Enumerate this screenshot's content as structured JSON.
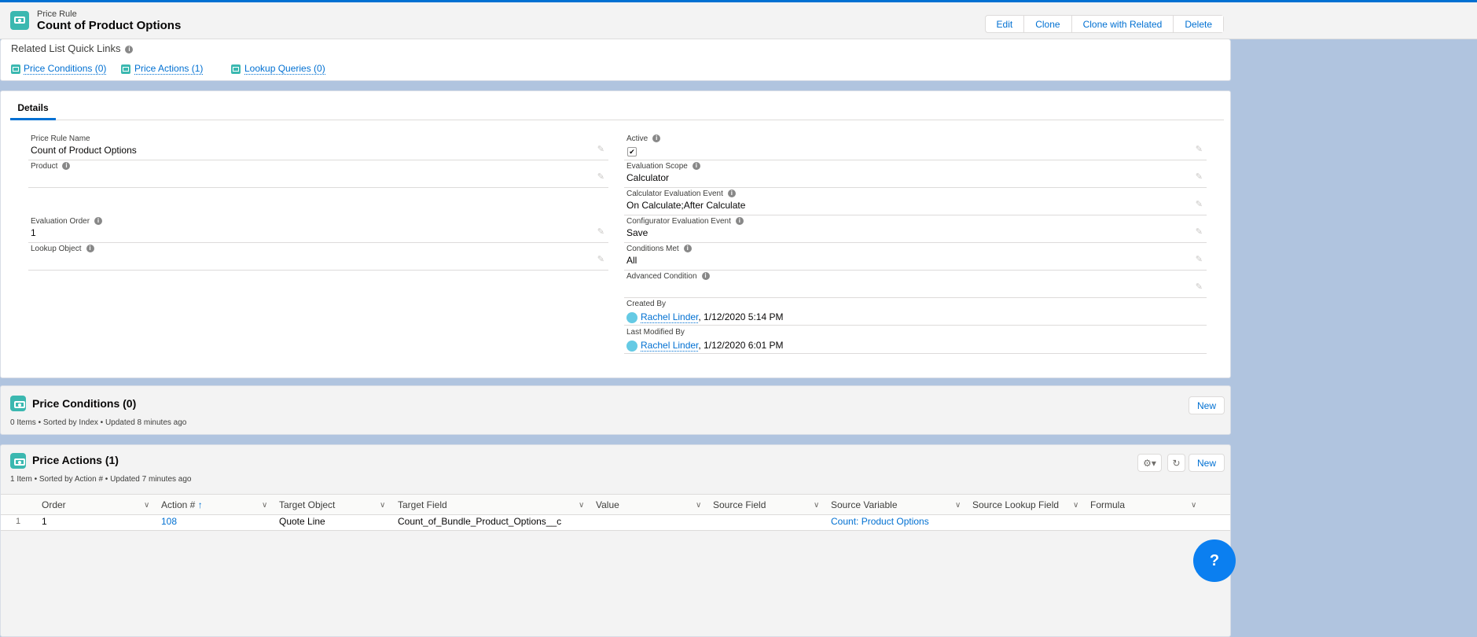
{
  "header": {
    "object_type": "Price Rule",
    "title": "Count of Product Options",
    "buttons": [
      "Edit",
      "Clone",
      "Clone with Related",
      "Delete"
    ]
  },
  "quick_links": {
    "title": "Related List Quick Links",
    "links": [
      "Price Conditions (0)",
      "Price Actions (1)",
      "Lookup Queries (0)"
    ]
  },
  "details": {
    "tab": "Details",
    "left": [
      {
        "label": "Price Rule Name",
        "value": "Count of Product Options"
      },
      {
        "label": "Product",
        "value": ""
      },
      {
        "label": "Evaluation Order",
        "value": "1"
      },
      {
        "label": "Lookup Object",
        "value": ""
      }
    ],
    "right": [
      {
        "label": "Active",
        "checked": true
      },
      {
        "label": "Evaluation Scope",
        "value": "Calculator"
      },
      {
        "label": "Calculator Evaluation Event",
        "value": "On Calculate;After Calculate"
      },
      {
        "label": "Configurator Evaluation Event",
        "value": "Save"
      },
      {
        "label": "Conditions Met",
        "value": "All"
      },
      {
        "label": "Advanced Condition",
        "value": ""
      }
    ],
    "created_by": {
      "label": "Created By",
      "user": "Rachel Linder",
      "date": ", 1/12/2020 5:14 PM"
    },
    "modified_by": {
      "label": "Last Modified By",
      "user": "Rachel Linder",
      "date": ", 1/12/2020 6:01 PM"
    }
  },
  "price_conditions": {
    "title": "Price Conditions (0)",
    "meta": "0 Items • Sorted by Index • Updated 8 minutes ago",
    "new_label": "New"
  },
  "price_actions": {
    "title": "Price Actions (1)",
    "meta": "1 Item • Sorted by Action # • Updated 7 minutes ago",
    "new_label": "New",
    "columns": [
      "Order",
      "Action #",
      "Target Object",
      "Target Field",
      "Value",
      "Source Field",
      "Source Variable",
      "Source Lookup Field",
      "Formula"
    ],
    "rows": [
      {
        "num": "1",
        "order": "1",
        "action": "108",
        "target_object": "Quote Line",
        "target_field": "Count_of_Bundle_Product_Options__c",
        "value": "",
        "source_field": "",
        "source_variable": "Count: Product Options",
        "source_lookup": "",
        "formula": ""
      }
    ]
  },
  "help": {
    "label": "?"
  }
}
